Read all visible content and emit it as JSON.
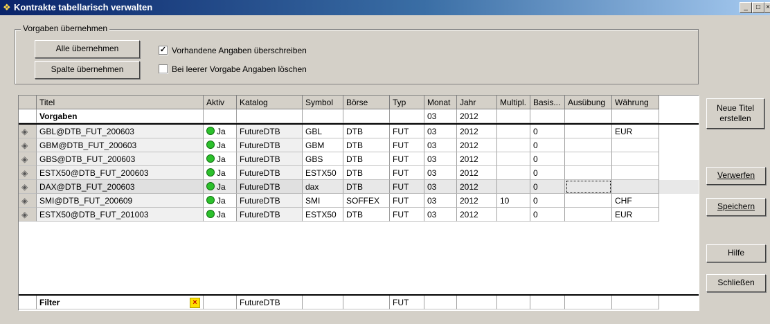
{
  "window": {
    "title": "Kontrakte tabellarisch verwalten",
    "minimize": "_",
    "maximize": "□",
    "close": "×"
  },
  "vorgaben_group": {
    "legend": "Vorgaben übernehmen",
    "alle_button": "Alle übernehmen",
    "spalte_button": "Spalte übernehmen",
    "overwrite_label": "Vorhandene Angaben überschreiben",
    "overwrite_checked": true,
    "delete_label": "Bei leerer Vorgabe Angaben löschen",
    "delete_checked": false
  },
  "table": {
    "columns": [
      "Titel",
      "Aktiv",
      "Katalog",
      "Symbol",
      "Börse",
      "Typ",
      "Monat",
      "Jahr",
      "Multipl.",
      "Basis...",
      "Ausübung",
      "Währung"
    ],
    "vorgaben_row": {
      "label": "Vorgaben",
      "monat": "03",
      "jahr": "2012"
    },
    "rows": [
      {
        "titel": "GBL@DTB_FUT_200603",
        "aktiv": "Ja",
        "katalog": "FutureDTB",
        "symbol": "GBL",
        "boerse": "DTB",
        "typ": "FUT",
        "monat": "03",
        "jahr": "2012",
        "multipl": "",
        "basis": "0",
        "ausuebung": "",
        "waehrung": "EUR"
      },
      {
        "titel": "GBM@DTB_FUT_200603",
        "aktiv": "Ja",
        "katalog": "FutureDTB",
        "symbol": "GBM",
        "boerse": "DTB",
        "typ": "FUT",
        "monat": "03",
        "jahr": "2012",
        "multipl": "",
        "basis": "0",
        "ausuebung": "",
        "waehrung": ""
      },
      {
        "titel": "GBS@DTB_FUT_200603",
        "aktiv": "Ja",
        "katalog": "FutureDTB",
        "symbol": "GBS",
        "boerse": "DTB",
        "typ": "FUT",
        "monat": "03",
        "jahr": "2012",
        "multipl": "",
        "basis": "0",
        "ausuebung": "",
        "waehrung": ""
      },
      {
        "titel": "ESTX50@DTB_FUT_200603",
        "aktiv": "Ja",
        "katalog": "FutureDTB",
        "symbol": "ESTX50",
        "boerse": "DTB",
        "typ": "FUT",
        "monat": "03",
        "jahr": "2012",
        "multipl": "",
        "basis": "0",
        "ausuebung": "",
        "waehrung": ""
      },
      {
        "titel": "DAX@DTB_FUT_200603",
        "aktiv": "Ja",
        "katalog": "FutureDTB",
        "symbol": "dax",
        "boerse": "DTB",
        "typ": "FUT",
        "monat": "03",
        "jahr": "2012",
        "multipl": "",
        "basis": "0",
        "ausuebung": "",
        "waehrung": ""
      },
      {
        "titel": "SMI@DTB_FUT_200609",
        "aktiv": "Ja",
        "katalog": "FutureDTB",
        "symbol": "SMI",
        "boerse": "SOFFEX",
        "typ": "FUT",
        "monat": "03",
        "jahr": "2012",
        "multipl": "10",
        "basis": "0",
        "ausuebung": "",
        "waehrung": "CHF"
      },
      {
        "titel": "ESTX50@DTB_FUT_201003",
        "aktiv": "Ja",
        "katalog": "FutureDTB",
        "symbol": "ESTX50",
        "boerse": "DTB",
        "typ": "FUT",
        "monat": "03",
        "jahr": "2012",
        "multipl": "",
        "basis": "0",
        "ausuebung": "",
        "waehrung": "EUR"
      }
    ],
    "filter_row": {
      "label": "Filter",
      "katalog": "FutureDTB",
      "typ": "FUT"
    }
  },
  "side_buttons": {
    "neue_titel": "Neue Titel erstellen",
    "verwerfen": "Verwerfen",
    "speichern": "Speichern",
    "hilfe": "Hilfe",
    "schliessen": "Schließen"
  },
  "colors": {
    "titlebar": "#0a246a",
    "aktiv_dot": "#2cc12c",
    "filter_clear": "#ffe000"
  },
  "icons": {
    "row_icon": "contract-icon",
    "filter_clear": "clear-filter-icon",
    "aktiv": "active-dot-icon"
  }
}
